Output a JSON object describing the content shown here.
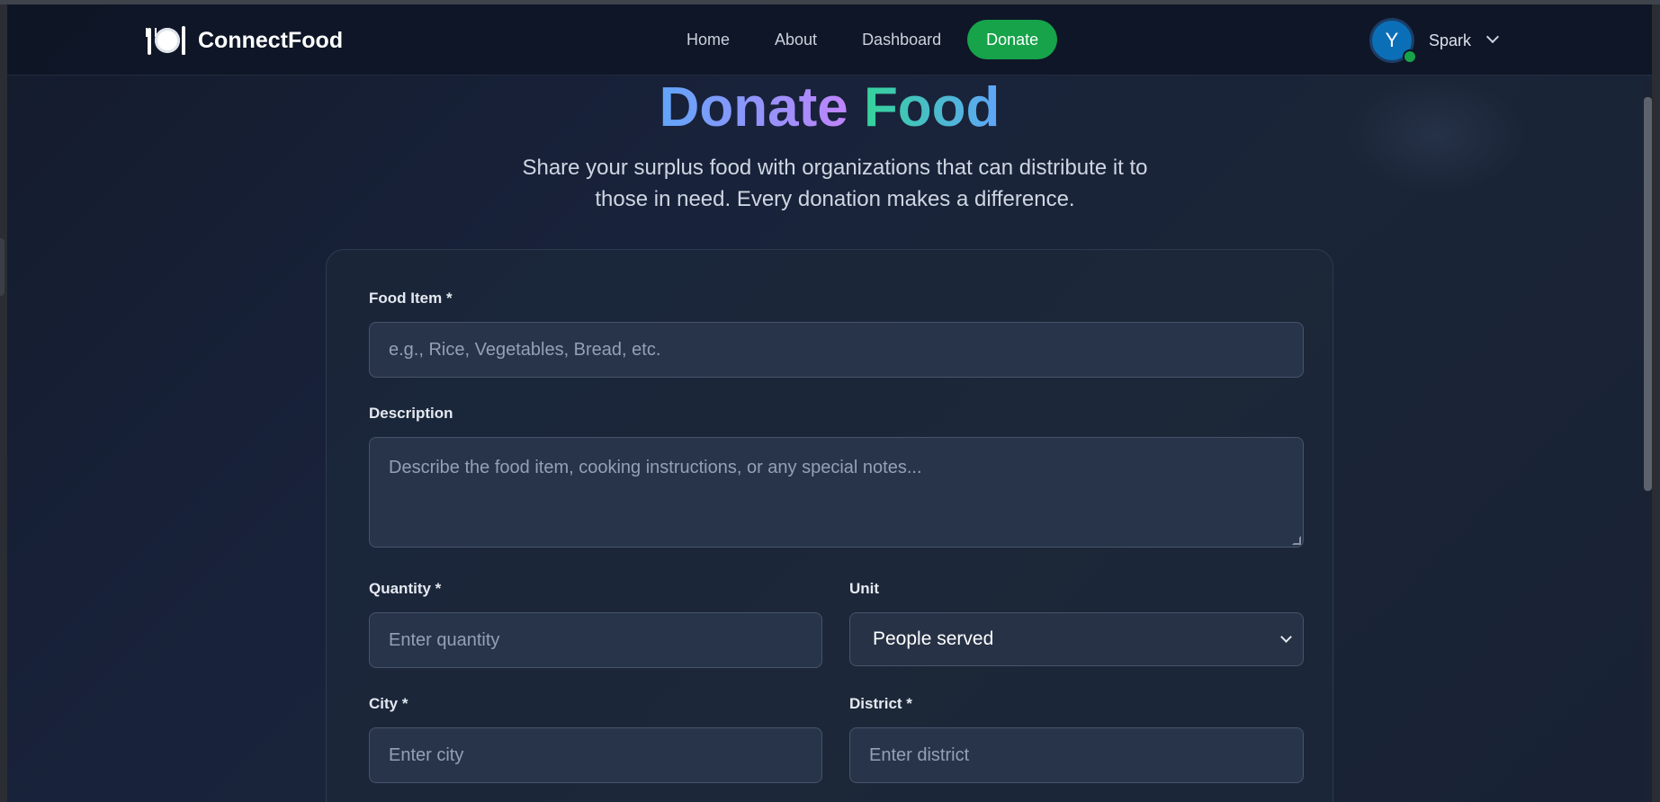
{
  "brand": {
    "name": "ConnectFood",
    "icon": "fork-knife-plate-icon"
  },
  "nav": {
    "links": [
      "Home",
      "About",
      "Dashboard"
    ],
    "donate_label": "Donate"
  },
  "user": {
    "initial": "Y",
    "name": "Spark",
    "status_color": "#16a34a"
  },
  "hero": {
    "title_word1": "Donate",
    "title_word2": "Food",
    "subtitle_line1": "Share your surplus food with organizations that can distribute it to",
    "subtitle_line2": "those in need. Every donation makes a difference."
  },
  "form": {
    "food_item": {
      "label": "Food Item *",
      "placeholder": "e.g., Rice, Vegetables, Bread, etc."
    },
    "description": {
      "label": "Description",
      "placeholder": "Describe the food item, cooking instructions, or any special notes..."
    },
    "quantity": {
      "label": "Quantity *",
      "placeholder": "Enter quantity"
    },
    "unit": {
      "label": "Unit",
      "selected": "People served"
    },
    "city": {
      "label": "City *",
      "placeholder": "Enter city"
    },
    "district": {
      "label": "District *",
      "placeholder": "Enter district"
    }
  },
  "colors": {
    "accent_green": "#16a34a",
    "avatar_blue": "#0b6fb8"
  }
}
